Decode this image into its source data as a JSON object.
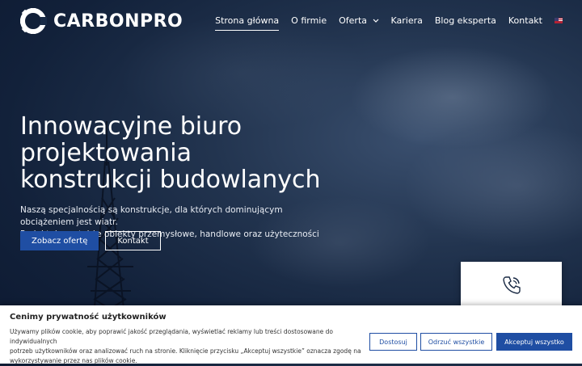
{
  "brand": {
    "name": "CARBONPRO"
  },
  "nav": {
    "items": [
      {
        "label": "Strona główna"
      },
      {
        "label": "O firmie"
      },
      {
        "label": "Oferta"
      },
      {
        "label": "Kariera"
      },
      {
        "label": "Blog eksperta"
      },
      {
        "label": "Kontakt"
      }
    ],
    "active": "Strona główna",
    "language_icon": "uk-flag-icon"
  },
  "hero": {
    "title_line1": "Innowacyjne biuro",
    "title_line2": "projektowania",
    "title_line3": "konstrukcji budowlanych",
    "desc_line1": "Naszą specjalnością są konstrukcje, dla których dominującym obciążeniem jest wiatr.",
    "desc_line2": "Projektujemy także obiekty przemysłowe, handlowe oraz użyteczności publicznej.",
    "primary_button": "Zobacz ofertę",
    "secondary_button": "Kontakt"
  },
  "contact_card": {
    "icon": "phone-icon"
  },
  "cookie": {
    "title": "Cenimy prywatność użytkowników",
    "text_line1": "Używamy plików cookie, aby poprawić jakość przeglądania, wyświetlać reklamy lub treści dostosowane do indywidualnych",
    "text_line2": "potrzeb użytkowników oraz analizować ruch na stronie. Kliknięcie przycisku „Akceptuj wszystkie” oznacza zgodę na",
    "text_line3": "wykorzystywanie przez nas plików cookie.",
    "customize": "Dostosuj",
    "reject": "Odrzuć wszystkie",
    "accept": "Akceptuj wszystko"
  },
  "colors": {
    "accent": "#1f4ea3",
    "background": "#12213a"
  }
}
